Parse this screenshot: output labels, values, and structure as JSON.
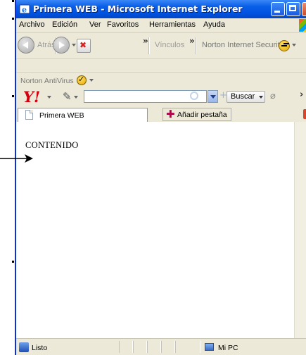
{
  "window": {
    "title": "Primera WEB - Microsoft Internet Explorer",
    "icon": "ie-icon",
    "controls": [
      "minimize",
      "maximize",
      "close"
    ]
  },
  "menubar": {
    "items": [
      "Archivo",
      "Edición",
      "Ver",
      "Favoritos",
      "Herramientas",
      "Ayuda"
    ]
  },
  "navbar": {
    "back_label": "Atrás",
    "links_label": "Vínculos",
    "norton_security_label": "Norton Internet Security",
    "chevron": "»"
  },
  "norton": {
    "label": "Norton AntiVirus"
  },
  "yahoo": {
    "logo": "Y!",
    "search_value": "",
    "search_button_label": "Buscar",
    "more_chevron": "›"
  },
  "tabs": {
    "items": [
      {
        "label": "Primera WEB"
      }
    ],
    "new_tab_label": "Añadir pestaña"
  },
  "content": {
    "text": "CONTENIDO"
  },
  "statusbar": {
    "status": "Listo",
    "zone": "Mi PC"
  },
  "colors": {
    "titlebar": "#0a5fe8",
    "chrome": "#ece9d8",
    "yahoo_red": "#d30010",
    "add_tab_plus": "#b5004c"
  }
}
